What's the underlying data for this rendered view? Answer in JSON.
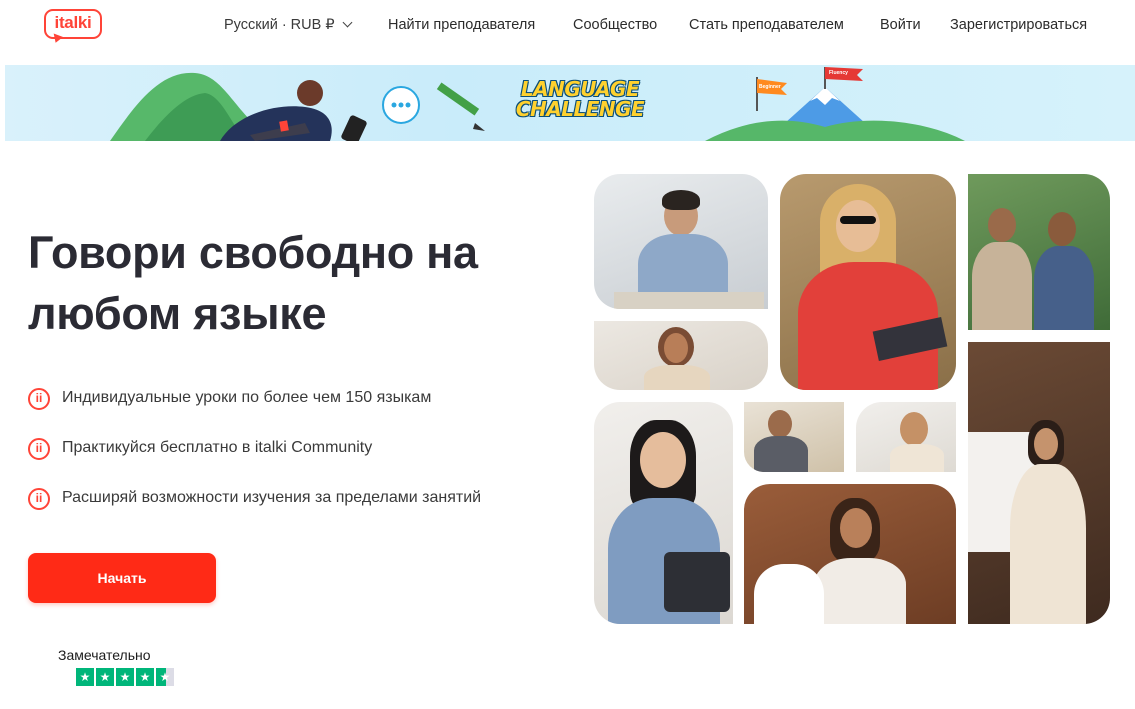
{
  "header": {
    "logo_text": "italki",
    "language_currency": "Русский · RUB ₽",
    "nav": [
      {
        "label": "Найти преподавателя"
      },
      {
        "label": "Сообщество"
      },
      {
        "label": "Стать преподавателем"
      },
      {
        "label": "Войти"
      },
      {
        "label": "Зарегистрироваться"
      }
    ]
  },
  "banner": {
    "title_line1": "LANGUAGE",
    "title_line2": "CHALLENGE",
    "flag1": "Beginner",
    "flag2": "Fluency"
  },
  "hero": {
    "title": "Говори свободно на любом языке",
    "features": [
      {
        "icon": "italki-ii-icon",
        "text": "Индивидуальные уроки по более чем 150 языкам"
      },
      {
        "icon": "italki-ii-icon",
        "text": "Практикуйся бесплатно в italki Community"
      },
      {
        "icon": "italki-ii-icon",
        "text": "Расширяй возможности изучения за пределами занятий"
      }
    ],
    "feature_icon_text": "ii",
    "cta_label": "Начать"
  },
  "trustpilot": {
    "label": "Замечательно",
    "rating_stars": 4.5
  },
  "colors": {
    "brand": "#ff4438",
    "cta": "#ff2a16",
    "trust_green": "#00b67a"
  }
}
